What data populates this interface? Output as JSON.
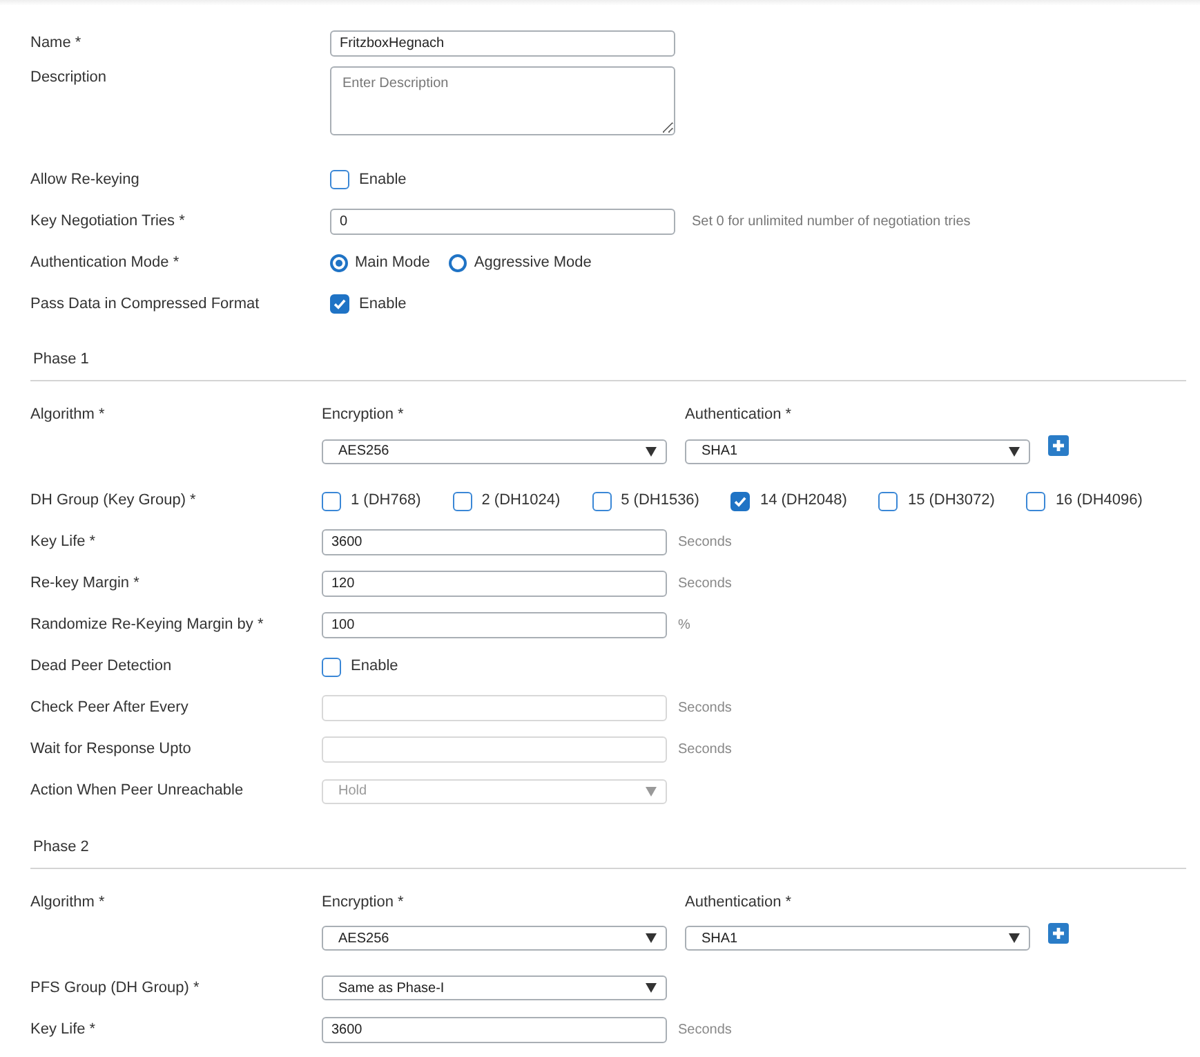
{
  "general": {
    "fields": [
      {
        "kind": "text",
        "label": "Name *",
        "value": "FritzboxHegnach"
      },
      {
        "kind": "textarea",
        "label": "Description",
        "placeholder": "Enter Description"
      },
      {
        "kind": "checkbox",
        "label": "Allow Re-keying",
        "option": "Enable",
        "checked": false
      },
      {
        "kind": "text",
        "label": "Key Negotiation Tries *",
        "value": "0",
        "hint": "Set 0 for unlimited number of negotiation tries"
      },
      {
        "kind": "radio",
        "label": "Authentication Mode *",
        "options": [
          {
            "label": "Main Mode",
            "selected": true
          },
          {
            "label": "Aggressive Mode",
            "selected": false
          }
        ]
      },
      {
        "kind": "checkbox",
        "label": "Pass Data in Compressed Format",
        "option": "Enable",
        "checked": true
      }
    ]
  },
  "phases": [
    {
      "title": "Phase 1",
      "algorithm": {
        "label": "Algorithm *",
        "encryption": {
          "label": "Encryption *",
          "value": "AES256"
        },
        "authentication": {
          "label": "Authentication *",
          "value": "SHA1"
        }
      },
      "fields": [
        {
          "kind": "checkgroup",
          "label": "DH Group (Key Group) *",
          "options": [
            {
              "label": "1 (DH768)",
              "checked": false
            },
            {
              "label": "2 (DH1024)",
              "checked": false
            },
            {
              "label": "5 (DH1536)",
              "checked": false
            },
            {
              "label": "14 (DH2048)",
              "checked": true
            },
            {
              "label": "15 (DH3072)",
              "checked": false
            },
            {
              "label": "16 (DH4096)",
              "checked": false
            }
          ]
        },
        {
          "kind": "text",
          "label": "Key Life *",
          "value": "3600",
          "unit": "Seconds",
          "disabled": false
        },
        {
          "kind": "text",
          "label": "Re-key Margin *",
          "value": "120",
          "unit": "Seconds",
          "disabled": false
        },
        {
          "kind": "text",
          "label": "Randomize Re-Keying Margin by *",
          "value": "100",
          "unit": "%",
          "disabled": false
        },
        {
          "kind": "checkbox",
          "label": "Dead Peer Detection",
          "option": "Enable",
          "checked": false
        },
        {
          "kind": "text",
          "label": "Check Peer After Every",
          "unit": "Seconds",
          "disabled": true
        },
        {
          "kind": "text",
          "label": "Wait for Response Upto",
          "unit": "Seconds",
          "disabled": true
        },
        {
          "kind": "select",
          "label": "Action When Peer Unreachable",
          "value": "Hold",
          "disabled": true
        }
      ]
    },
    {
      "title": "Phase 2",
      "algorithm": {
        "label": "Algorithm *",
        "encryption": {
          "label": "Encryption *",
          "value": "AES256"
        },
        "authentication": {
          "label": "Authentication *",
          "value": "SHA1"
        }
      },
      "fields": [
        {
          "kind": "select",
          "label": "PFS Group (DH Group) *",
          "value": "Same as Phase-I",
          "disabled": false
        },
        {
          "kind": "text",
          "label": "Key Life *",
          "value": "3600",
          "unit": "Seconds",
          "disabled": false
        }
      ]
    }
  ]
}
